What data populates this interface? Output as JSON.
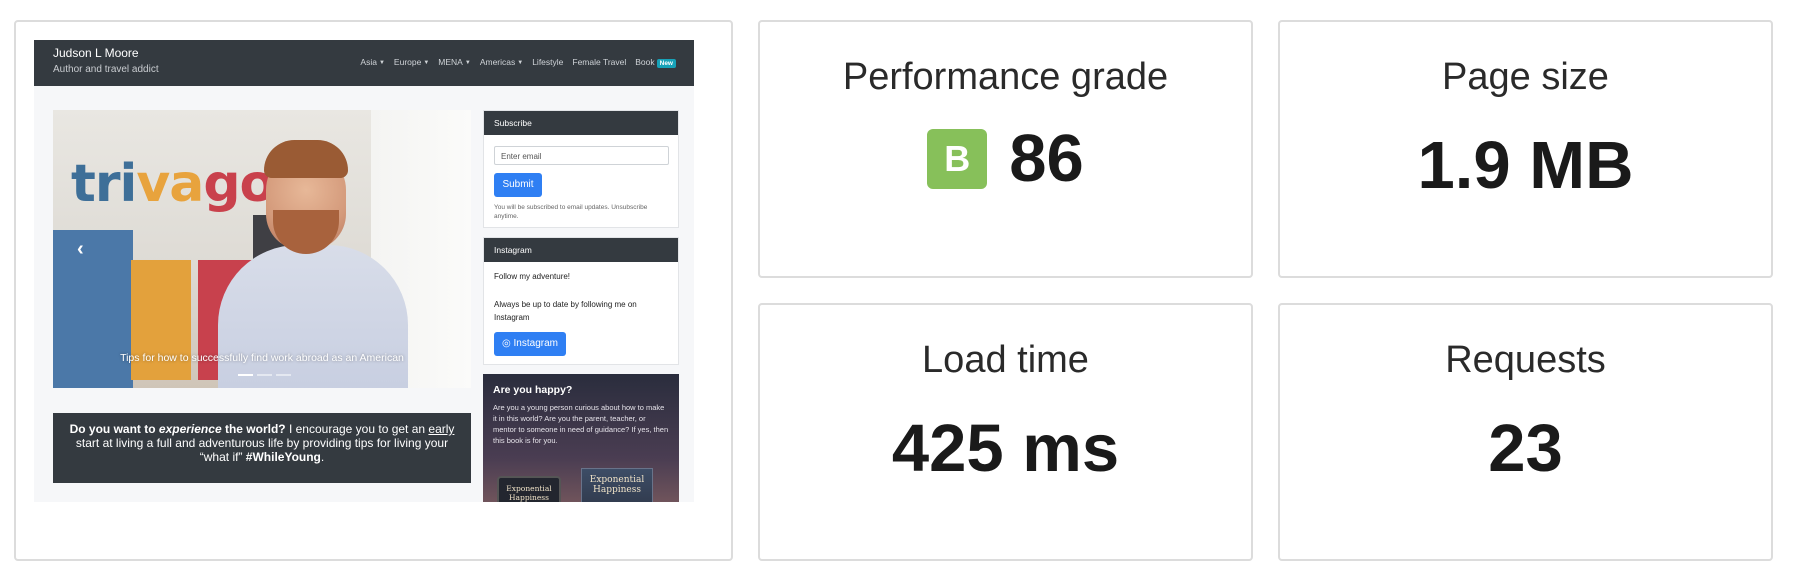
{
  "screenshot": {
    "site": {
      "brand_name": "Judson L Moore",
      "brand_tagline": "Author and travel addict",
      "nav": [
        {
          "label": "Asia",
          "dropdown": true
        },
        {
          "label": "Europe",
          "dropdown": true
        },
        {
          "label": "MENA",
          "dropdown": true
        },
        {
          "label": "Americas",
          "dropdown": true
        },
        {
          "label": "Lifestyle",
          "dropdown": false
        },
        {
          "label": "Female Travel",
          "dropdown": false
        },
        {
          "label": "Book",
          "dropdown": false,
          "badge": "New"
        }
      ],
      "carousel": {
        "logo_parts": [
          "tri",
          "va",
          "go"
        ],
        "prev_icon": "‹",
        "caption": "Tips for how to successfully find work abroad as an American",
        "indicator_count": 3,
        "active_indicator": 1
      },
      "intro": {
        "p1": "Do you want to ",
        "p2": "experience",
        "p3": " the world?",
        "p4": " I encourage you to get an ",
        "p5": "early",
        "p6": " start at living a full and adventurous life by providing tips for living your “what if” ",
        "p7": "#WhileYoung",
        "p8": "."
      },
      "subscribe": {
        "heading": "Subscribe",
        "email_placeholder": "Enter email",
        "submit_label": "Submit",
        "note": "You will be subscribed to email updates. Unsubscribe anytime."
      },
      "instagram": {
        "heading": "Instagram",
        "follow": "Follow my adventure!",
        "text": "Always be up to date by following me on Instagram",
        "button_label": "Instagram",
        "button_icon": "◎"
      },
      "book": {
        "title": "Are you happy?",
        "text": "Are you a young person curious about how to make it in this world? Are you the parent, teacher, or mentor to someone in need of guidance? If yes, then this book is for you.",
        "cover_title": "Exponential Happiness",
        "tablet_title": "Exponential Happiness"
      }
    }
  },
  "metrics": {
    "grade": {
      "title": "Performance grade",
      "letter": "B",
      "score": "86",
      "color": "#87c05a"
    },
    "size": {
      "title": "Page size",
      "value": "1.9 MB"
    },
    "load": {
      "title": "Load time",
      "value": "425 ms"
    },
    "requests": {
      "title": "Requests",
      "value": "23"
    }
  }
}
